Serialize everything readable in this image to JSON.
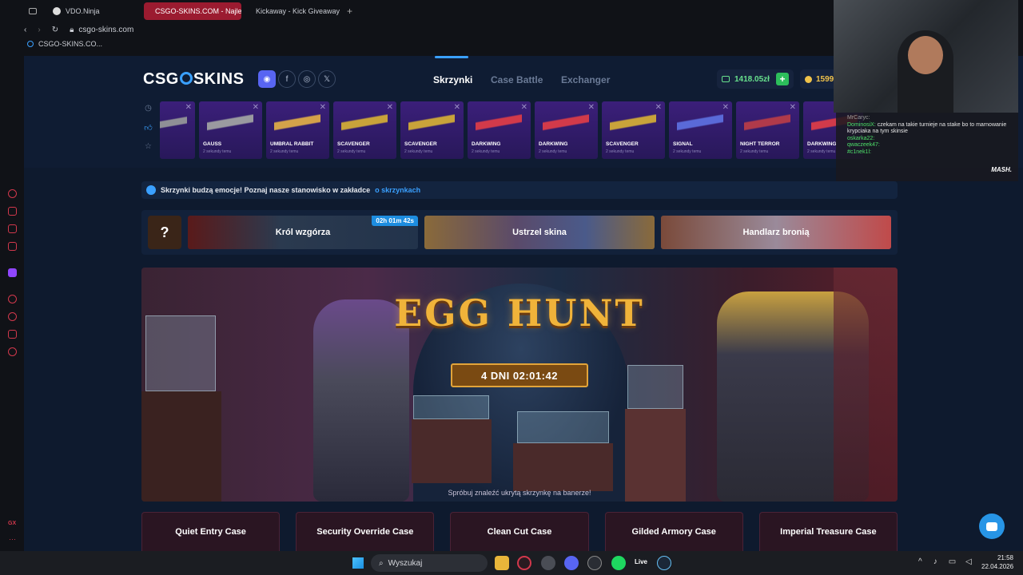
{
  "browser": {
    "tabs": [
      {
        "label": "VDO.Ninja",
        "active": false
      },
      {
        "label": "CSGO-SKINS.COM - Najle",
        "active": true
      },
      {
        "label": "Kickaway - Kick Giveaway",
        "active": false
      }
    ],
    "url": "csgo-skins.com",
    "bookmark": "CSGO-SKINS.CO..."
  },
  "site": {
    "logo": "CSGOSKINS",
    "nav": [
      "Skrzynki",
      "Case Battle",
      "Exchanger"
    ],
    "balance": "1418.05zł",
    "coins": "1599",
    "live_drops": [
      {
        "name": "",
        "color": "#8f8f96"
      },
      {
        "name": "GAUSS",
        "time": "2 sekundy temu",
        "color": "#9a9aa0"
      },
      {
        "name": "UMBRAL RABBIT",
        "time": "2 sekundy temu",
        "color": "#d4a24a"
      },
      {
        "name": "SCAVENGER",
        "time": "2 sekundy temu",
        "color": "#c9a33a"
      },
      {
        "name": "SCAVENGER",
        "time": "2 sekundy temu",
        "color": "#c9a33a"
      },
      {
        "name": "DARKWING",
        "time": "2 sekundy temu",
        "color": "#d23a4a"
      },
      {
        "name": "DARKWING",
        "time": "2 sekundy temu",
        "color": "#d23a4a"
      },
      {
        "name": "SCAVENGER",
        "time": "2 sekundy temu",
        "color": "#c9a33a"
      },
      {
        "name": "SIGNAL",
        "time": "2 sekundy temu",
        "color": "#5a6ad8"
      },
      {
        "name": "NIGHT TERROR",
        "time": "2 sekundy temu",
        "color": "#b03a4a"
      },
      {
        "name": "DARKWING",
        "time": "2 sekundy temu",
        "color": "#d23a4a"
      }
    ],
    "info_text": "Skrzynki budzą emocje! Poznaj nasze stanowisko w zakładce",
    "info_link": "o skrzynkach",
    "events": [
      {
        "label": "Król wzgórza",
        "timer": "02h 01m 42s"
      },
      {
        "label": "Ustrzel skina"
      },
      {
        "label": "Handlarz bronią"
      }
    ],
    "mystery": "?",
    "banner": {
      "title": "EGG HUNT",
      "countdown": "4 DNI 02:01:42",
      "hint": "Spróbuj znaleźć ukrytą skrzynkę na banerze!"
    },
    "cases": [
      "Quiet Entry Case",
      "Security Override Case",
      "Clean Cut Case",
      "Gilded Armory Case",
      "Imperial Treasure Case"
    ]
  },
  "stream_chat": [
    {
      "user": "MrCaryc:",
      "text": ""
    },
    {
      "user": "DominosiX:",
      "text": "czekam na takie turnieje na stake bo to marnowanie krypciaka na tym skinsie"
    },
    {
      "user": "oskarka22:",
      "text": ""
    },
    {
      "user": "qwaczeek47:",
      "text": ""
    },
    {
      "user": "#c1nek1l:",
      "text": ""
    }
  ],
  "stream_logo": "MASH.",
  "taskbar": {
    "search": "Wyszukaj",
    "time": "21:58",
    "date": "22.04.2026",
    "live_label": "Live"
  },
  "sidebar_badge": "GX"
}
